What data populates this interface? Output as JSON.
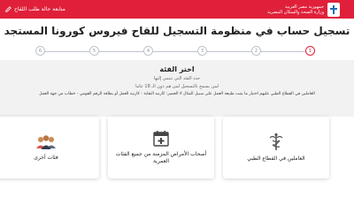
{
  "header": {
    "org_line1": "جمهورية مصر العربية",
    "org_line2": "وزارة الصحة والسكان المصرية",
    "track_link": "متابعة حالة طلب اللقاح",
    "colors": {
      "bar": "#e0203a"
    }
  },
  "page": {
    "title": "تسجيل حساب في منظومة التسجيل للقاح فيروس كورونا المستجد"
  },
  "steps": {
    "active": "1",
    "items": [
      "6",
      "5",
      "4",
      "3",
      "2",
      "1"
    ]
  },
  "category": {
    "heading": "اختر الفئة",
    "sub1": "حدد الفئة التي تنتمي إليها",
    "sub2": "لمن يسمح بالتسجيل لمن هم دون الـ 18 عاما",
    "note": "العاملين في القطاع الطبي عليهم اختيار ما يثبت طبيعة العمل على سبيل المثال لا الحصر: كارنيه النقابة - كارنيه العمل أو بطاقة الرقم القومي - خطاب من جهة العمل"
  },
  "cards": [
    {
      "label": "العاملين في القطاع الطبي",
      "icon": "caduceus-icon"
    },
    {
      "label": "أصحاب الأمراض المزمنة من جميع الفئات العمرية",
      "icon": "medical-calendar-icon"
    },
    {
      "label": "فئات أخرى",
      "icon": "people-group-icon"
    }
  ]
}
